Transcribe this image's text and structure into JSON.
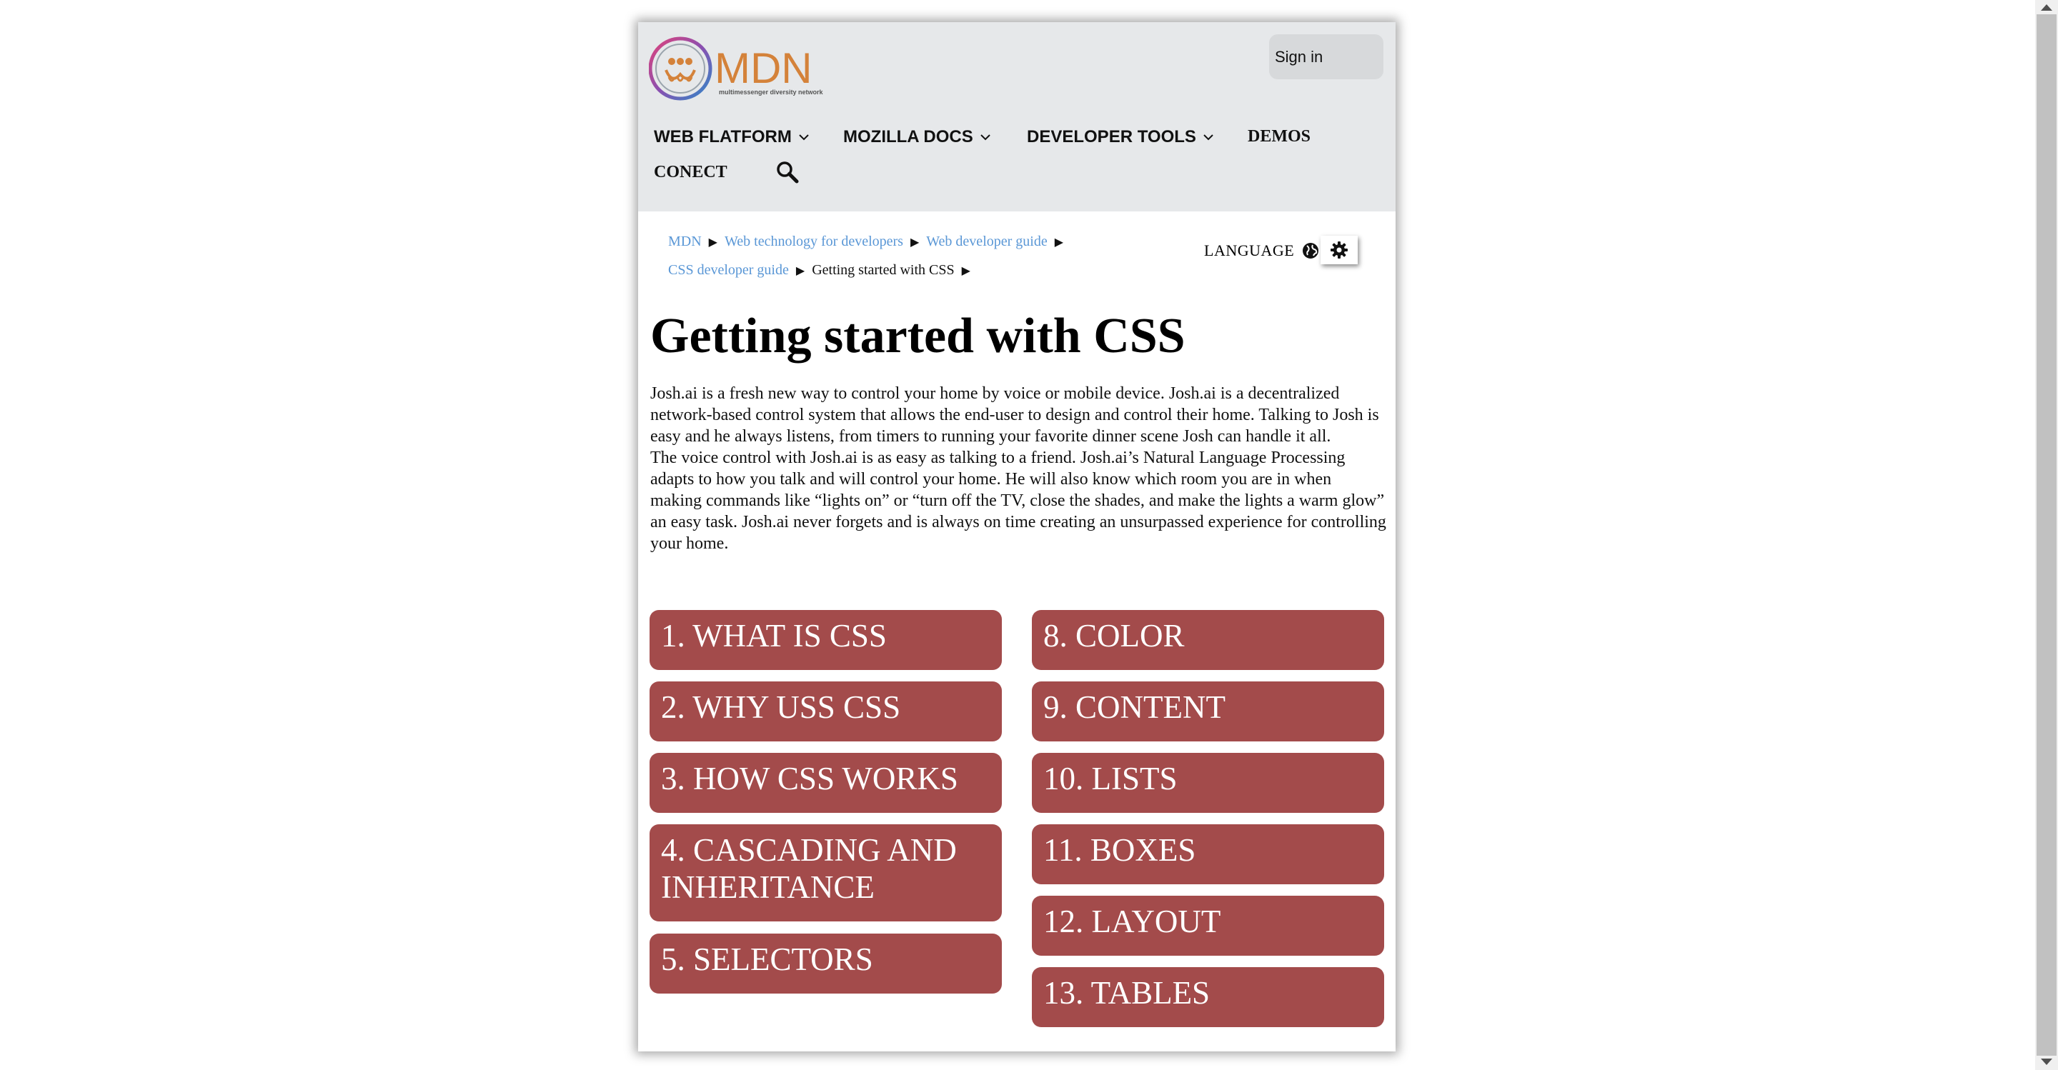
{
  "header": {
    "logo_text": "MDN",
    "logo_tagline": "multimessenger diversity network",
    "signin_label": "Sign in"
  },
  "nav": {
    "items": [
      {
        "label": "WEB FLATFORM",
        "icon": "chevron-down-icon"
      },
      {
        "label": "MOZILLA DOCS",
        "icon": "chevron-down-icon"
      },
      {
        "label": "DEVELOPER TOOLS",
        "icon": "chevron-down-icon"
      },
      {
        "label": "DEMOS"
      },
      {
        "label": "CONECT"
      }
    ],
    "search_icon": "search-icon"
  },
  "breadcrumb": {
    "items": [
      "MDN",
      "Web technology for developers",
      "Web developer guide",
      "CSS developer guide",
      "Getting started with CSS"
    ],
    "separator": "▶"
  },
  "language": {
    "label": "LANGUAGE",
    "icon": "globe-icon"
  },
  "settings": {
    "icon": "gear-icon"
  },
  "main": {
    "title": "Getting started with CSS",
    "paragraphs": [
      "Josh.ai is a fresh new way to control your home by voice or mobile device. Josh.ai is a decentralized network-based control system that allows the end-user to design and control their home. Talking to Josh is easy and he always listens, from timers to running your favorite dinner scene Josh can handle it all.",
      "The voice control with Josh.ai is as easy as talking to a friend. Josh.ai’s Natural Language Processing adapts to how you talk and will control your home. He will also know which room you are in when making commands like “lights on” or “turn off the TV, close the shades, and make the lights a warm glow” an easy task. Josh.ai never forgets and is always on time creating an unsurpassed experience for controlling your home."
    ]
  },
  "topics": {
    "left": [
      "1. WHAT IS CSS",
      "2. WHY USS CSS",
      "3. HOW CSS WORKS",
      "4. CASCADING AND INHERITANCE",
      "5. SELECTORS"
    ],
    "right": [
      "8. COLOR",
      "9. CONTENT",
      "10. LISTS",
      "11. BOXES",
      "12. LAYOUT",
      "13. TABLES"
    ]
  },
  "colors": {
    "header_bg": "#e6e8ea",
    "card_bg": "#a34b4b",
    "link": "#5a97d6",
    "logo_orange": "#d4823a"
  }
}
